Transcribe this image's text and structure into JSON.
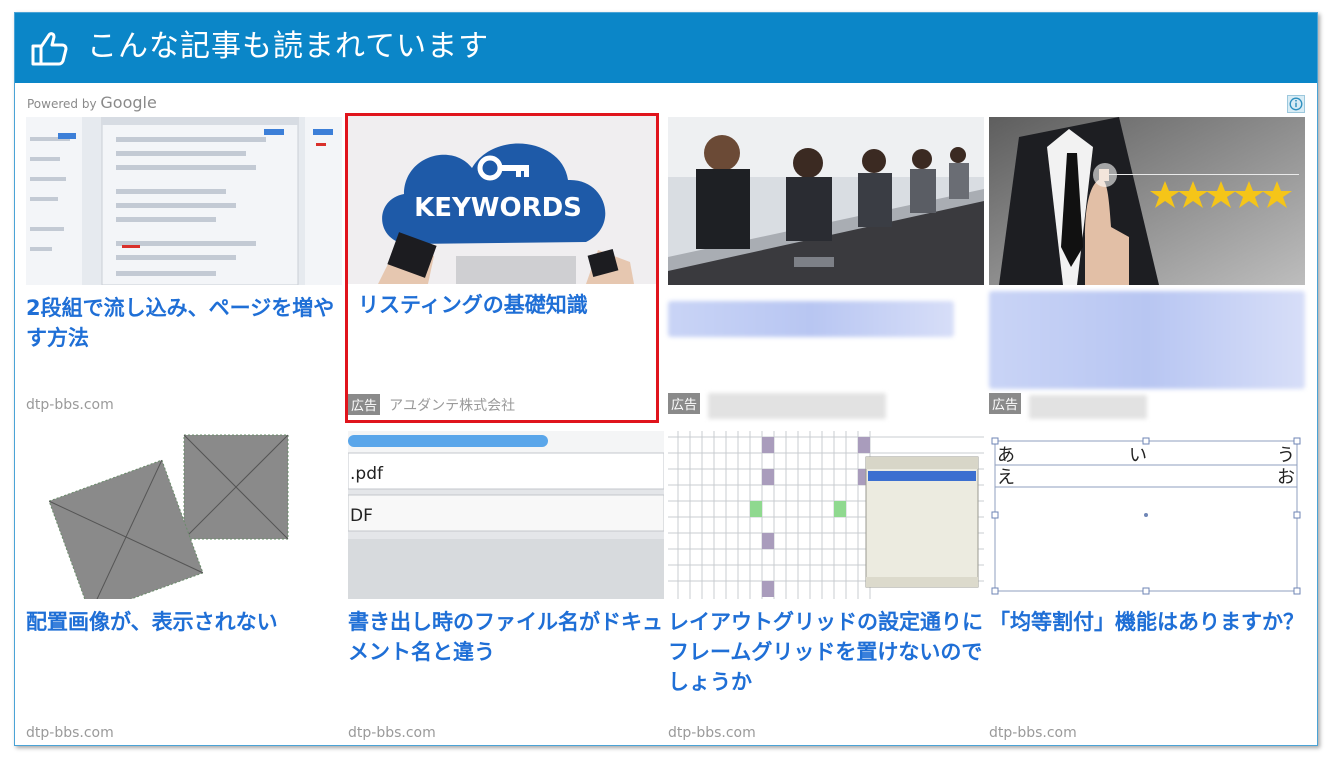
{
  "header": {
    "title": "こんな記事も読まれています"
  },
  "powered": {
    "prefix": "Powered by",
    "brand": "Google"
  },
  "row1": [
    {
      "title": "2段組で流し込み、ページを増やす方法",
      "source": "dtp-bbs.com"
    },
    {
      "title": "リスティングの基礎知識",
      "ad_label": "広告",
      "advertiser": "アユダンテ株式会社",
      "image_text": "KEYWORDS"
    },
    {
      "ad_label": "広告"
    },
    {
      "ad_label": "広告"
    }
  ],
  "row2": [
    {
      "title": "配置画像が、表示されない",
      "source": "dtp-bbs.com"
    },
    {
      "title": "書き出し時のファイル名がドキュメント名と違う",
      "source": "dtp-bbs.com",
      "image_text_1": ".pdf",
      "image_text_2": "DF"
    },
    {
      "title": "レイアウトグリッドの設定通りにフレームグリッドを置けないのでしょうか",
      "source": "dtp-bbs.com"
    },
    {
      "title": "「均等割付」機能はありますか？",
      "source": "dtp-bbs.com",
      "image_chars": [
        "あ",
        "い",
        "う",
        "え",
        "お"
      ]
    }
  ],
  "colors": {
    "header_bg": "#0b86c8",
    "link": "#1f6fd6",
    "highlight": "#e0141c"
  }
}
